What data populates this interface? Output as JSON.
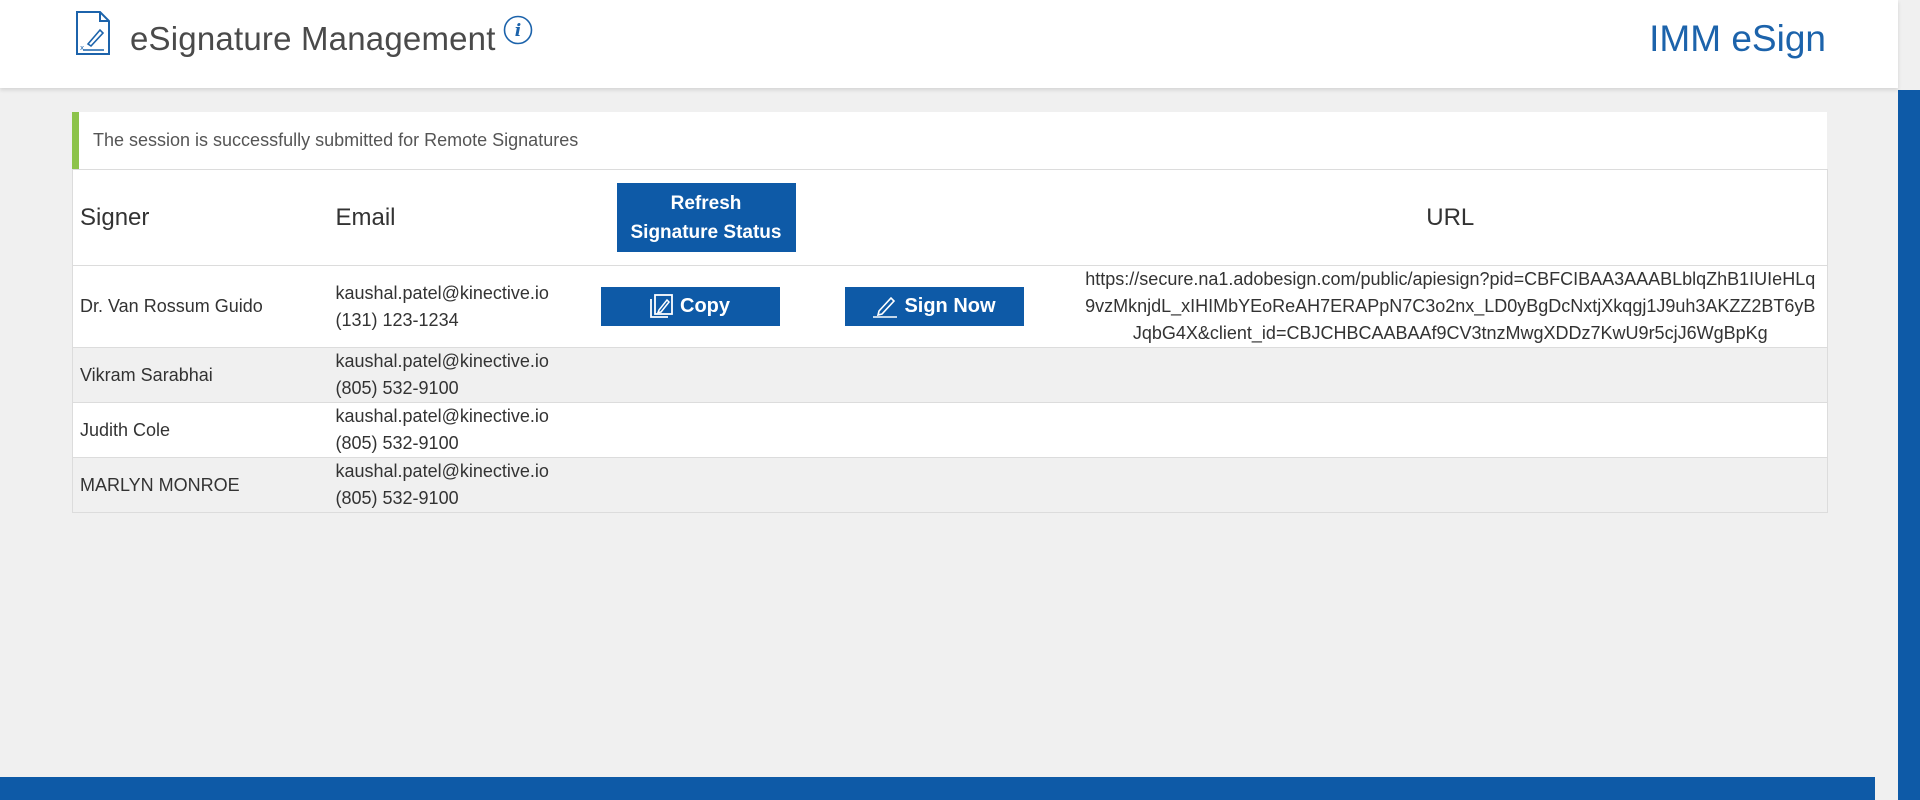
{
  "header": {
    "title": "eSignature Management",
    "brand": "IMM eSign",
    "icons": {
      "document": "document-sign-icon",
      "info": "info-icon"
    }
  },
  "banner": {
    "message": "The session is successfully submitted for Remote Signatures"
  },
  "table": {
    "columns": {
      "signer": "Signer",
      "email": "Email",
      "url": "URL"
    },
    "refresh_button": {
      "line1": "Refresh",
      "line2": "Signature Status"
    },
    "copy_label": "Copy",
    "sign_now_label": "Sign Now",
    "rows": [
      {
        "signer": "Dr. Van Rossum Guido",
        "email": "kaushal.patel@kinective.io",
        "phone": "(131) 123-1234",
        "url": "https://secure.na1.adobesign.com/public/apiesign?pid=CBFCIBAA3AAABLblqZhB1IUIeHLq9vzMknjdL_xIHIMbYEoReAH7ERAPpN7C3o2nx_LD0yBgDcNxtjXkqgj1J9uh3AKZZ2BT6yBJqbG4X&client_id=CBJCHBCAABAAf9CV3tnzMwgXDDz7KwU9r5cjJ6WgBpKg"
      },
      {
        "signer": "Vikram Sarabhai",
        "email": "kaushal.patel@kinective.io",
        "phone": "(805) 532-9100"
      },
      {
        "signer": "Judith Cole",
        "email": "kaushal.patel@kinective.io",
        "phone": "(805) 532-9100"
      },
      {
        "signer": "MARLYN MONROE",
        "email": "kaushal.patel@kinective.io",
        "phone": "(805) 532-9100"
      }
    ]
  },
  "colors": {
    "primary": "#0e5aa7",
    "brand_text": "#1c63ab",
    "success_accent": "#8cc34a",
    "background": "#f0f0f0"
  }
}
